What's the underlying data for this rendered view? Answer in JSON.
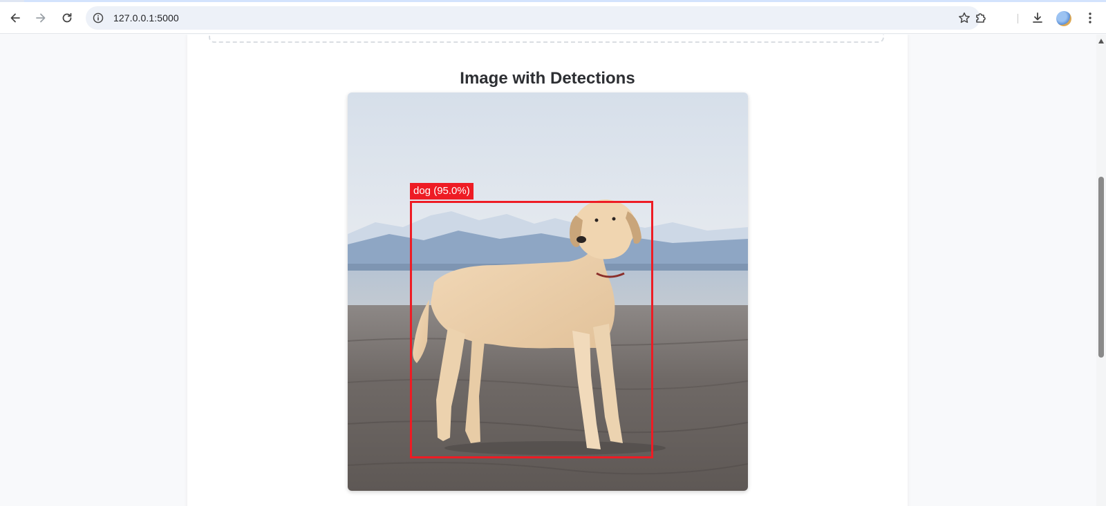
{
  "browser": {
    "url": "127.0.0.1:5000",
    "icons": {
      "back": "back-arrow-icon",
      "forward": "forward-arrow-icon",
      "reload": "reload-icon",
      "site_info": "info-icon",
      "bookmark": "star-icon",
      "extensions": "puzzle-icon",
      "downloads": "download-icon",
      "profile": "avatar",
      "menu": "kebab-menu-icon"
    }
  },
  "page": {
    "section_title": "Image with Detections",
    "detections": [
      {
        "label": "dog (95.0%)",
        "class": "dog",
        "confidence": 95.0,
        "color": "#ee1c24"
      }
    ]
  }
}
